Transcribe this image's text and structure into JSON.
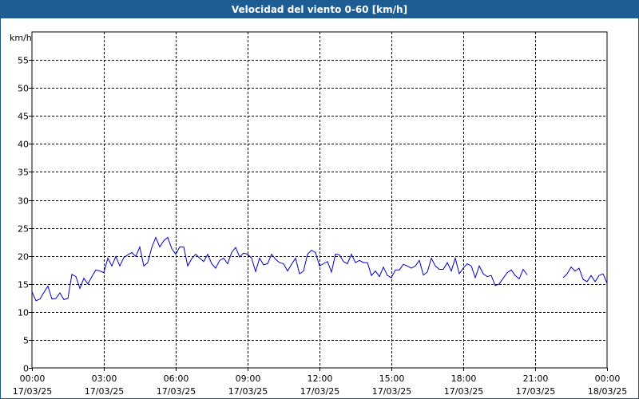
{
  "chart_data": {
    "type": "line",
    "title": "Velocidad del viento 0-60 [km/h]",
    "ylabel": "km/h",
    "xlabel": "",
    "ylim": [
      0,
      60
    ],
    "yticks": [
      0,
      5,
      10,
      15,
      20,
      25,
      30,
      35,
      40,
      45,
      50,
      55
    ],
    "xlim": [
      "2025-03-17 00:00",
      "2025-03-18 00:00"
    ],
    "xticks": [
      {
        "time": "00:00",
        "date": "17/03/25"
      },
      {
        "time": "03:00",
        "date": "17/03/25"
      },
      {
        "time": "06:00",
        "date": "17/03/25"
      },
      {
        "time": "09:00",
        "date": "17/03/25"
      },
      {
        "time": "12:00",
        "date": "17/03/25"
      },
      {
        "time": "15:00",
        "date": "17/03/25"
      },
      {
        "time": "18:00",
        "date": "17/03/25"
      },
      {
        "time": "21:00",
        "date": "17/03/25"
      },
      {
        "time": "00:00",
        "date": "18/03/25"
      }
    ],
    "grid": true,
    "line_color": "#0000cc",
    "series": [
      {
        "segments": [
          [
            [
              "00:00",
              13.6
            ],
            [
              "00:10",
              12.0
            ],
            [
              "00:20",
              12.3
            ],
            [
              "00:30",
              13.5
            ],
            [
              "00:40",
              14.6
            ],
            [
              "00:50",
              12.3
            ],
            [
              "01:00",
              12.4
            ],
            [
              "01:10",
              13.4
            ],
            [
              "01:20",
              12.2
            ],
            [
              "01:30",
              12.4
            ],
            [
              "01:40",
              16.7
            ],
            [
              "01:50",
              16.3
            ],
            [
              "02:00",
              14.2
            ],
            [
              "02:10",
              16.0
            ],
            [
              "02:20",
              15.0
            ],
            [
              "02:30",
              16.3
            ],
            [
              "02:40",
              17.5
            ],
            [
              "02:50",
              17.3
            ],
            [
              "03:00",
              17.0
            ],
            [
              "03:10",
              19.6
            ],
            [
              "03:20",
              18.2
            ],
            [
              "03:30",
              19.9
            ],
            [
              "03:40",
              18.2
            ],
            [
              "03:50",
              19.7
            ],
            [
              "04:00",
              20.2
            ],
            [
              "04:10",
              20.6
            ],
            [
              "04:20",
              19.9
            ],
            [
              "04:30",
              21.6
            ],
            [
              "04:40",
              18.2
            ],
            [
              "04:50",
              18.8
            ],
            [
              "05:00",
              21.5
            ],
            [
              "05:10",
              23.3
            ],
            [
              "05:20",
              21.6
            ],
            [
              "05:30",
              22.7
            ],
            [
              "05:40",
              23.3
            ],
            [
              "05:50",
              21.3
            ],
            [
              "06:00",
              20.3
            ],
            [
              "06:10",
              21.6
            ],
            [
              "06:20",
              21.6
            ],
            [
              "06:30",
              18.2
            ],
            [
              "06:40",
              19.5
            ],
            [
              "06:50",
              20.3
            ],
            [
              "07:00",
              19.6
            ],
            [
              "07:10",
              19.0
            ],
            [
              "07:20",
              20.3
            ],
            [
              "07:30",
              18.6
            ],
            [
              "07:40",
              17.8
            ],
            [
              "07:50",
              19.2
            ],
            [
              "08:00",
              19.6
            ],
            [
              "08:10",
              18.6
            ],
            [
              "08:20",
              20.6
            ],
            [
              "08:30",
              21.5
            ],
            [
              "08:40",
              19.8
            ],
            [
              "08:50",
              20.5
            ],
            [
              "09:00",
              20.3
            ],
            [
              "09:10",
              19.6
            ],
            [
              "09:20",
              17.2
            ],
            [
              "09:30",
              19.6
            ],
            [
              "09:40",
              18.4
            ],
            [
              "09:50",
              18.6
            ],
            [
              "10:00",
              20.3
            ],
            [
              "10:10",
              19.4
            ],
            [
              "10:20",
              18.8
            ],
            [
              "10:30",
              18.6
            ],
            [
              "10:40",
              17.3
            ],
            [
              "10:50",
              18.5
            ],
            [
              "11:00",
              19.6
            ],
            [
              "11:10",
              16.8
            ],
            [
              "11:20",
              17.3
            ],
            [
              "11:30",
              20.3
            ],
            [
              "11:40",
              21.0
            ],
            [
              "11:50",
              20.6
            ],
            [
              "12:00",
              18.2
            ],
            [
              "12:10",
              18.6
            ],
            [
              "12:20",
              19.0
            ],
            [
              "12:30",
              17.1
            ],
            [
              "12:40",
              20.3
            ],
            [
              "12:50",
              20.2
            ],
            [
              "13:00",
              19.0
            ],
            [
              "13:10",
              18.6
            ],
            [
              "13:20",
              20.3
            ],
            [
              "13:30",
              18.8
            ],
            [
              "13:40",
              19.2
            ],
            [
              "13:50",
              18.8
            ],
            [
              "14:00",
              18.8
            ],
            [
              "14:10",
              16.5
            ],
            [
              "14:20",
              17.3
            ],
            [
              "14:30",
              16.3
            ],
            [
              "14:40",
              18.0
            ],
            [
              "14:50",
              16.5
            ],
            [
              "15:00",
              16.1
            ],
            [
              "15:10",
              17.5
            ],
            [
              "15:20",
              17.5
            ],
            [
              "15:30",
              18.5
            ],
            [
              "15:40",
              18.2
            ],
            [
              "15:50",
              17.8
            ],
            [
              "16:00",
              18.2
            ],
            [
              "16:10",
              19.2
            ],
            [
              "16:20",
              16.6
            ],
            [
              "16:30",
              17.1
            ],
            [
              "16:40",
              19.6
            ],
            [
              "16:50",
              18.2
            ],
            [
              "17:00",
              17.6
            ],
            [
              "17:10",
              17.6
            ],
            [
              "17:20",
              18.8
            ],
            [
              "17:30",
              17.3
            ],
            [
              "17:40",
              19.6
            ],
            [
              "17:50",
              16.8
            ],
            [
              "18:00",
              17.8
            ],
            [
              "18:10",
              18.6
            ],
            [
              "18:20",
              18.2
            ],
            [
              "18:30",
              16.1
            ],
            [
              "18:40",
              18.2
            ],
            [
              "18:50",
              16.8
            ],
            [
              "19:00",
              16.3
            ],
            [
              "19:10",
              16.5
            ],
            [
              "19:20",
              14.7
            ],
            [
              "19:30",
              15.0
            ],
            [
              "19:40",
              16.0
            ],
            [
              "19:50",
              17.0
            ],
            [
              "20:00",
              17.5
            ],
            [
              "20:10",
              16.5
            ],
            [
              "20:20",
              15.9
            ],
            [
              "20:30",
              17.6
            ],
            [
              "20:40",
              16.6
            ]
          ],
          [
            [
              "22:10",
              16.1
            ],
            [
              "22:20",
              16.8
            ],
            [
              "22:30",
              18.0
            ],
            [
              "22:40",
              17.3
            ],
            [
              "22:50",
              17.8
            ],
            [
              "23:00",
              15.8
            ],
            [
              "23:10",
              15.4
            ],
            [
              "23:20",
              16.5
            ],
            [
              "23:30",
              15.4
            ],
            [
              "23:40",
              16.5
            ],
            [
              "23:50",
              16.8
            ],
            [
              "24:00",
              15.1
            ]
          ]
        ]
      }
    ]
  }
}
